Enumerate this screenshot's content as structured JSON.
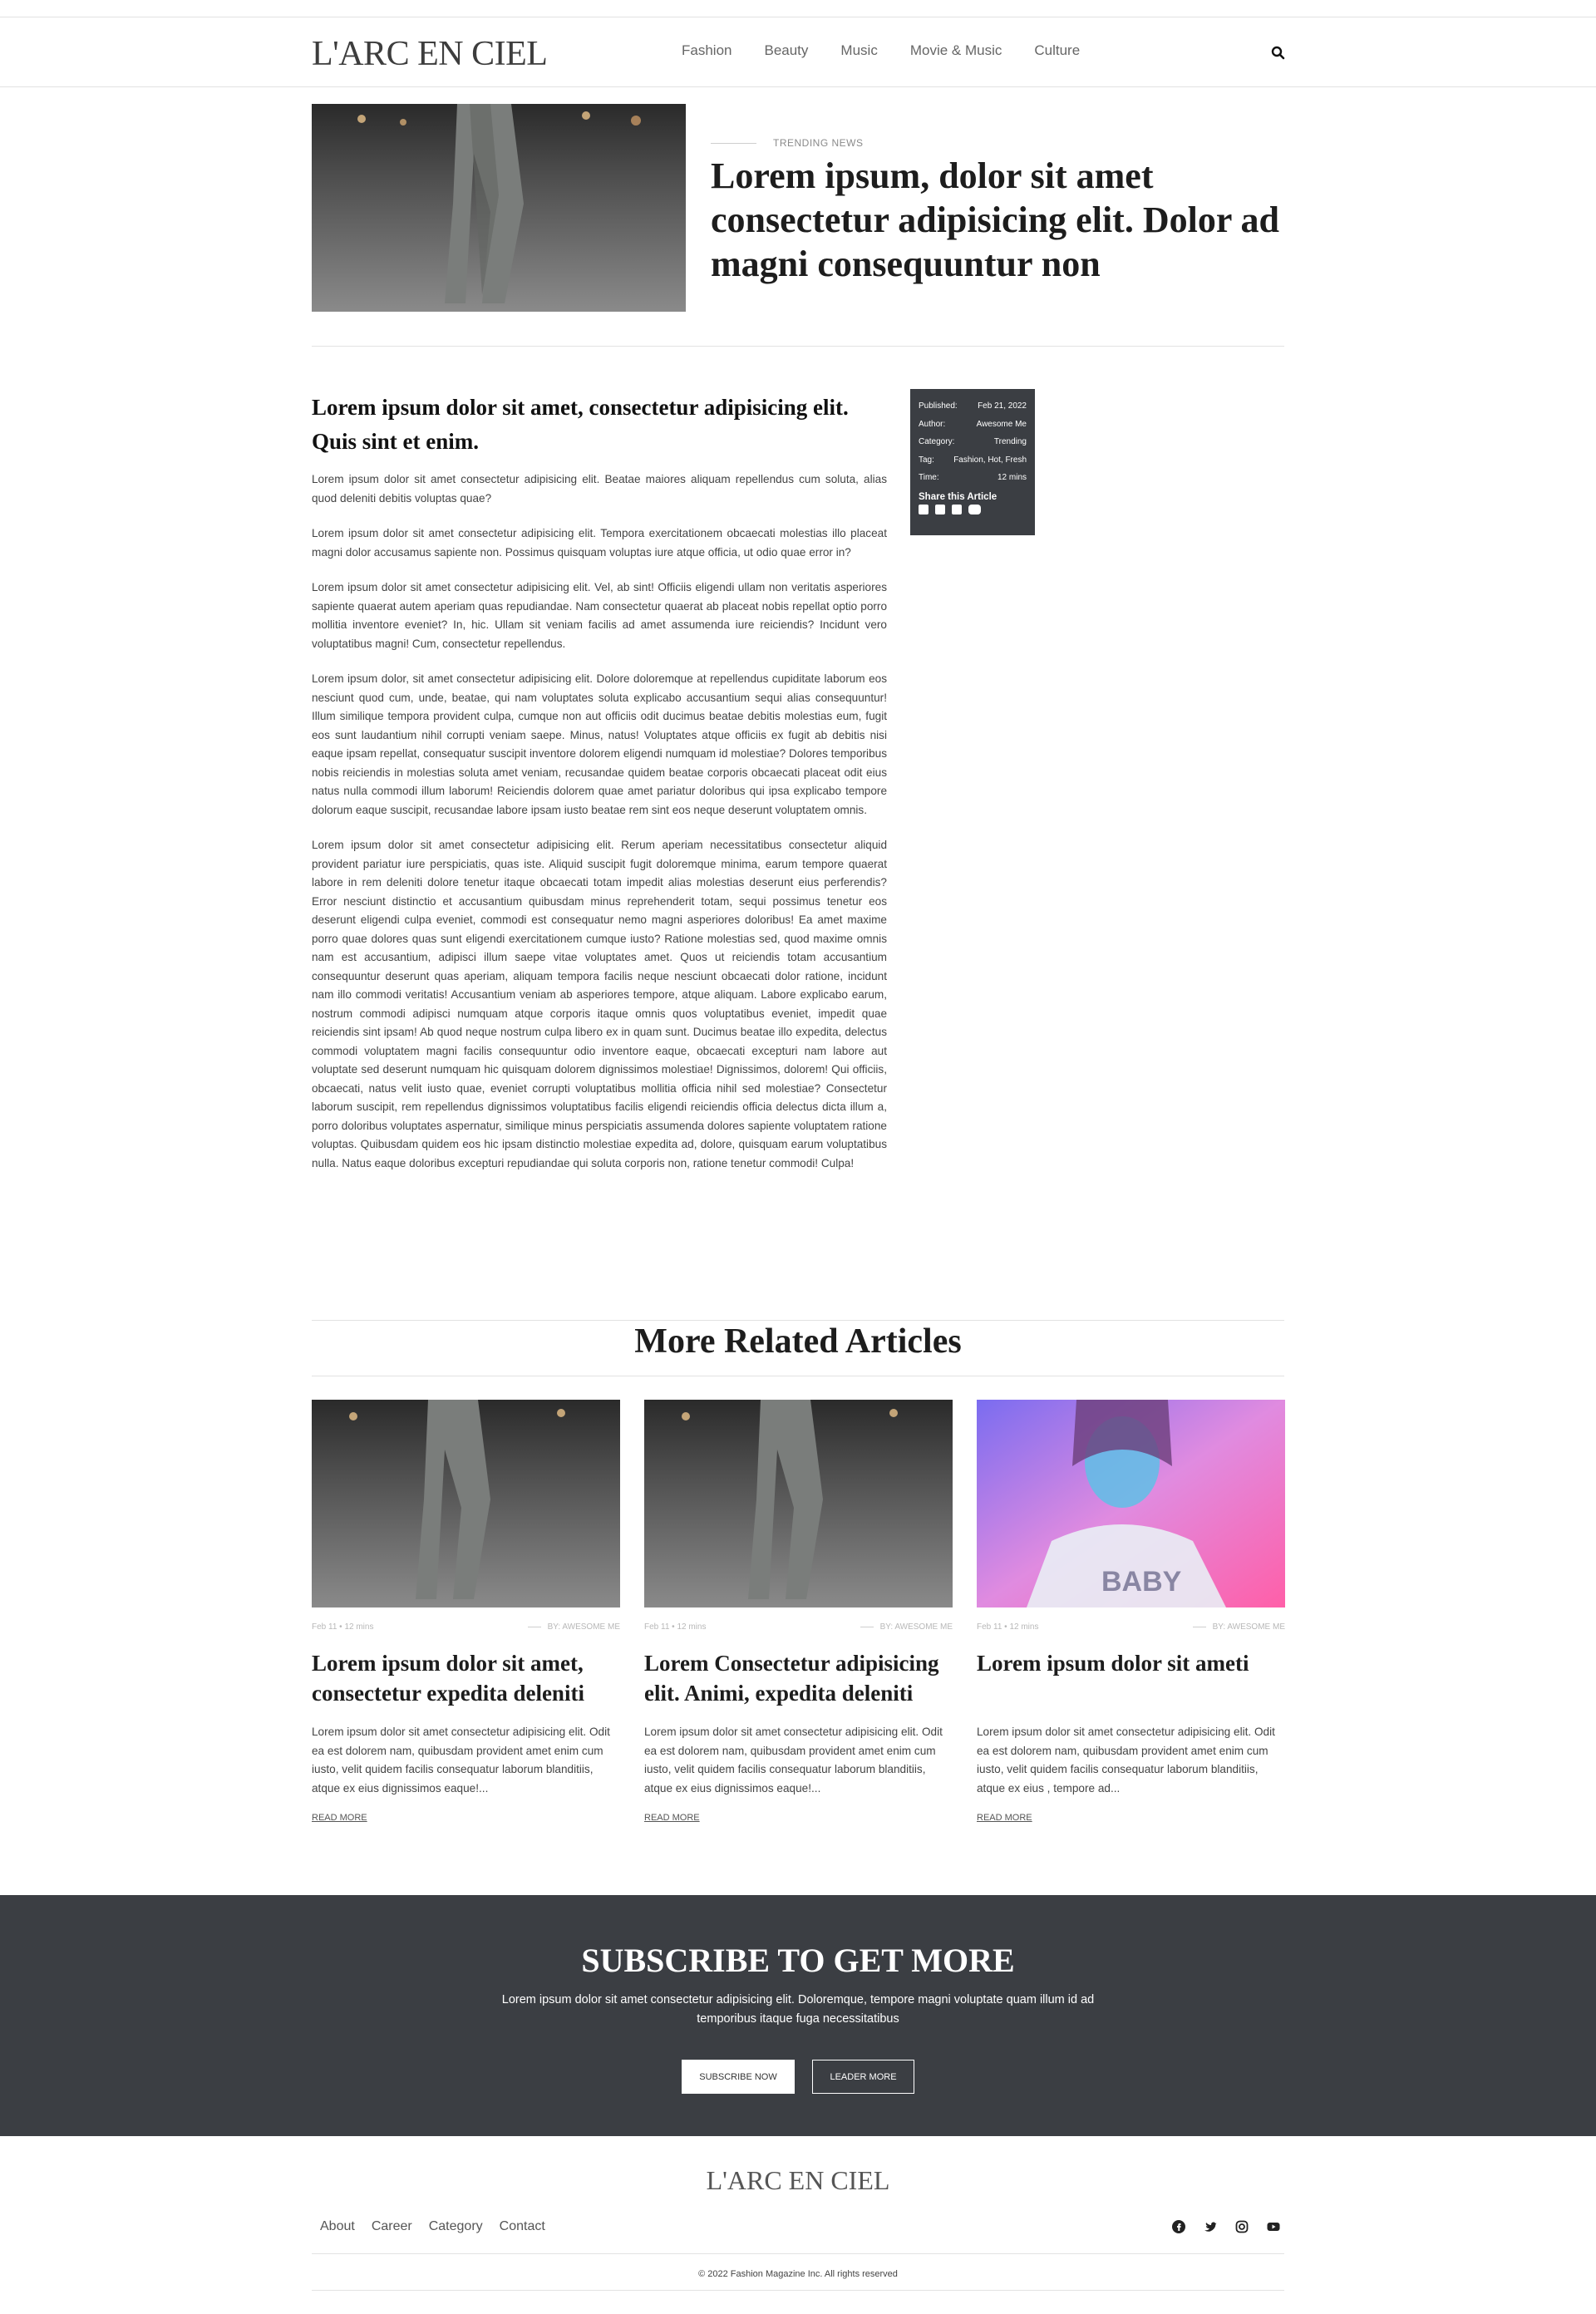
{
  "brand": {
    "logo": "L'ARC EN CIEL"
  },
  "nav": {
    "items": [
      "Fashion",
      "Beauty",
      "Music",
      "Movie & Music",
      "Culture"
    ]
  },
  "hero": {
    "kicker": "TRENDING NEWS",
    "title": "Lorem ipsum, dolor sit amet consectetur adipisicing elit. Dolor ad magni consequuntur non"
  },
  "article": {
    "lead": "Lorem ipsum dolor sit amet, consectetur adipisicing elit. Quis sint et enim.",
    "paragraphs": [
      "Lorem ipsum dolor sit amet consectetur adipisicing elit. Beatae maiores aliquam repellendus cum soluta, alias quod deleniti debitis voluptas quae?",
      "Lorem ipsum dolor sit amet consectetur adipisicing elit. Tempora exercitationem obcaecati molestias illo placeat magni dolor accusamus sapiente non. Possimus quisquam voluptas iure atque officia, ut odio quae error in?",
      "Lorem ipsum dolor sit amet consectetur adipisicing elit. Vel, ab sint! Officiis eligendi ullam non veritatis asperiores sapiente quaerat autem aperiam quas repudiandae. Nam consectetur quaerat ab placeat nobis repellat optio porro mollitia inventore eveniet? In, hic. Ullam sit veniam facilis ad amet assumenda iure reiciendis? Incidunt vero voluptatibus magni! Cum, consectetur repellendus.",
      "Lorem ipsum dolor, sit amet consectetur adipisicing elit. Dolore doloremque at repellendus cupiditate laborum eos nesciunt quod cum, unde, beatae, qui nam voluptates soluta explicabo accusantium sequi alias consequuntur! Illum similique tempora provident culpa, cumque non aut officiis odit ducimus beatae debitis molestias eum, fugit eos sunt laudantium nihil corrupti veniam saepe. Minus, natus! Voluptates atque officiis ex fugit ab debitis nisi eaque ipsam repellat, consequatur suscipit inventore dolorem eligendi numquam id molestiae? Dolores temporibus nobis reiciendis in molestias soluta amet veniam, recusandae quidem beatae corporis obcaecati placeat odit eius natus nulla commodi illum laborum! Reiciendis dolorem quae amet pariatur doloribus qui ipsa explicabo tempore dolorum eaque suscipit, recusandae labore ipsam iusto beatae rem sint eos neque deserunt voluptatem omnis.",
      "Lorem ipsum dolor sit amet consectetur adipisicing elit. Rerum aperiam necessitatibus consectetur aliquid provident pariatur iure perspiciatis, quas iste. Aliquid suscipit fugit doloremque minima, earum tempore quaerat labore in rem deleniti dolore tenetur itaque obcaecati totam impedit alias molestias deserunt eius perferendis? Error nesciunt distinctio et accusantium quibusdam minus reprehenderit totam, sequi possimus tenetur eos deserunt eligendi culpa eveniet, commodi est consequatur nemo magni asperiores doloribus! Ea amet maxime porro quae dolores quas sunt eligendi exercitationem cumque iusto? Ratione molestias sed, quod maxime omnis nam est accusantium, adipisci illum saepe vitae voluptates amet. Quos ut reiciendis totam accusantium consequuntur deserunt quas aperiam, aliquam tempora facilis neque nesciunt obcaecati dolor ratione, incidunt nam illo commodi veritatis! Accusantium veniam ab asperiores tempore, atque aliquam. Labore explicabo earum, nostrum commodi adipisci numquam atque corporis itaque omnis quos voluptatibus eveniet, impedit quae reiciendis sint ipsam! Ab quod neque nostrum culpa libero ex in quam sunt. Ducimus beatae illo expedita, delectus commodi voluptatem magni facilis consequuntur odio inventore eaque, obcaecati excepturi nam labore aut voluptate sed deserunt numquam hic quisquam dolorem dignissimos molestiae! Dignissimos, dolorem! Qui officiis, obcaecati, natus velit iusto quae, eveniet corrupti voluptatibus mollitia officia nihil sed molestiae? Consectetur laborum suscipit, rem repellendus dignissimos voluptatibus facilis eligendi reiciendis officia delectus dicta illum a, porro doloribus voluptates aspernatur, similique minus perspiciatis assumenda dolores sapiente voluptatem ratione voluptas. Quibusdam quidem eos hic ipsam distinctio molestiae expedita ad, dolore, quisquam earum voluptatibus nulla. Natus eaque doloribus excepturi repudiandae qui soluta corporis non, ratione tenetur commodi! Culpa!"
    ]
  },
  "meta": {
    "rows": [
      {
        "label": "Published:",
        "value": "Feb 21, 2022"
      },
      {
        "label": "Author:",
        "value": "Awesome Me"
      },
      {
        "label": "Category:",
        "value": "Trending"
      },
      {
        "label": "Tag:",
        "value": "Fashion, Hot, Fresh"
      },
      {
        "label": "Time:",
        "value": "12 mins"
      }
    ],
    "share_title": "Share this Article",
    "share_icons": [
      "facebook-icon",
      "twitter-icon",
      "instagram-icon",
      "youtube-icon"
    ]
  },
  "related": {
    "title": "More Related Articles",
    "cards": [
      {
        "date": "Feb 11 • 12 mins",
        "by": "BY: AWESOME ME",
        "title": "Lorem ipsum dolor sit amet, consectetur expedita deleniti",
        "text": "Lorem ipsum dolor sit amet consectetur adipisicing elit. Odit ea est dolorem nam, quibusdam provident amet enim cum iusto, velit quidem facilis consequatur laborum blanditiis, atque ex eius dignissimos eaque!...",
        "link": "READ MORE"
      },
      {
        "date": "Feb 11 • 12 mins",
        "by": "BY: AWESOME ME",
        "title": "Lorem Consectetur adipisicing elit. Animi, expedita deleniti",
        "text": "Lorem ipsum dolor sit amet consectetur adipisicing elit. Odit ea est dolorem nam, quibusdam provident amet enim cum iusto, velit quidem facilis consequatur laborum blanditiis, atque ex eius dignissimos eaque!...",
        "link": "READ MORE"
      },
      {
        "date": "Feb 11 • 12 mins",
        "by": "BY: AWESOME ME",
        "title": "Lorem ipsum dolor sit ameti",
        "text": "Lorem ipsum dolor sit amet consectetur adipisicing elit. Odit ea est dolorem nam, quibusdam provident amet enim cum iusto, velit quidem facilis consequatur laborum blanditiis, atque ex eius , tempore ad...",
        "link": "READ MORE"
      }
    ]
  },
  "subscribe": {
    "title": "SUBSCRIBE TO GET MORE",
    "text": "Lorem ipsum dolor sit amet consectetur adipisicing elit. Doloremque, tempore magni voluptate quam illum id ad temporibus itaque fuga necessitatibus",
    "primary_button": "SUBSCRIBE NOW",
    "secondary_button": "LEADER MORE"
  },
  "footer": {
    "logo": "L'ARC EN CIEL",
    "links": [
      "About",
      "Career",
      "Category",
      "Contact"
    ],
    "social_icons": [
      "facebook-icon",
      "twitter-icon",
      "instagram-icon",
      "youtube-icon"
    ],
    "copyright": "© 2022 Fashion Magazine Inc. All rights reserved"
  },
  "colors": {
    "dark_panel": "#3b3e43",
    "text": "#333333",
    "divider": "#e2e2e2"
  }
}
